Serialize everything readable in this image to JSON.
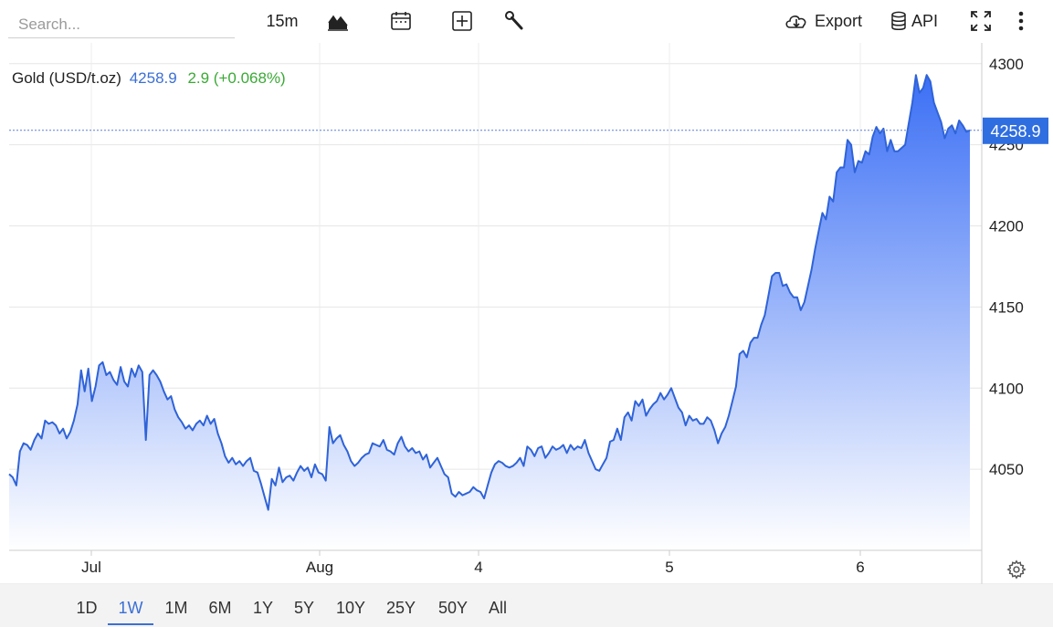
{
  "toolbar": {
    "search_placeholder": "Search...",
    "interval": "15m",
    "export_label": "Export",
    "api_label": "API",
    "icons": [
      "chart-type-icon",
      "calendar-icon",
      "add-indicator-icon",
      "wrench-icon",
      "cloud-download-icon",
      "database-icon",
      "fullscreen-icon",
      "more-vertical-icon"
    ]
  },
  "quote": {
    "name": "Gold (USD/t.oz)",
    "price": "4258.9",
    "change": "2.9 (+0.068%)"
  },
  "ranges": [
    "1D",
    "1W",
    "1M",
    "6M",
    "1Y",
    "5Y",
    "10Y",
    "25Y",
    "50Y",
    "All"
  ],
  "active_range": "1W",
  "colors": {
    "line": "#2f63d8",
    "area_top": "#3b6ff5",
    "area_bottom": "#ffffff",
    "price_label_bg": "#2f6ee0",
    "positive": "#3aaa35",
    "grid": "#e6e6e6"
  },
  "chart_data": {
    "type": "area",
    "title": "Gold (USD/t.oz)",
    "x_tick_labels": [
      "Jul",
      "Aug",
      "4",
      "5",
      "6"
    ],
    "y_ticks": [
      4050,
      4100,
      4150,
      4200,
      4250,
      4300
    ],
    "y_tick_labels": [
      "4050",
      "4100",
      "4150",
      "4200",
      "4250",
      "4300"
    ],
    "ylim": [
      4000,
      4312.8
    ],
    "last_price_label": "4258.9",
    "grid": true,
    "series": [
      {
        "values": [
          4047,
          4045,
          4040,
          4061,
          4066,
          4065,
          4062,
          4068,
          4072,
          4069,
          4080,
          4078,
          4079,
          4077,
          4072,
          4075,
          4069,
          4073,
          4080,
          4090,
          4111,
          4098,
          4112,
          4092,
          4101,
          4114,
          4116,
          4108,
          4110,
          4105,
          4102,
          4113,
          4104,
          4101,
          4112,
          4107,
          4114,
          4110,
          4068,
          4108,
          4111,
          4108,
          4104,
          4098,
          4093,
          4095,
          4087,
          4082,
          4079,
          4075,
          4077,
          4074,
          4078,
          4080,
          4077,
          4083,
          4078,
          4081,
          4072,
          4066,
          4058,
          4054,
          4057,
          4053,
          4055,
          4052,
          4055,
          4057,
          4049,
          4048,
          4041,
          4033,
          4025,
          4044,
          4040,
          4051,
          4042,
          4045,
          4046,
          4043,
          4048,
          4052,
          4049,
          4051,
          4045,
          4053,
          4048,
          4047,
          4043,
          4076,
          4066,
          4069,
          4071,
          4065,
          4061,
          4055,
          4052,
          4054,
          4057,
          4059,
          4060,
          4066,
          4065,
          4064,
          4068,
          4062,
          4061,
          4059,
          4066,
          4070,
          4064,
          4061,
          4063,
          4060,
          4061,
          4056,
          4059,
          4051,
          4054,
          4057,
          4052,
          4047,
          4045,
          4035,
          4033,
          4036,
          4034,
          4035,
          4036,
          4039,
          4037,
          4036,
          4032,
          4040,
          4048,
          4053,
          4055,
          4054,
          4052,
          4051,
          4052,
          4054,
          4057,
          4052,
          4064,
          4062,
          4058,
          4063,
          4064,
          4057,
          4060,
          4064,
          4062,
          4063,
          4065,
          4060,
          4065,
          4062,
          4064,
          4063,
          4068,
          4060,
          4055,
          4050,
          4049,
          4053,
          4057,
          4067,
          4068,
          4075,
          4068,
          4082,
          4085,
          4080,
          4092,
          4089,
          4093,
          4083,
          4087,
          4090,
          4092,
          4097,
          4093,
          4096,
          4100,
          4094,
          4088,
          4085,
          4077,
          4083,
          4080,
          4081,
          4078,
          4078,
          4082,
          4080,
          4074,
          4066,
          4072,
          4076,
          4083,
          4092,
          4101,
          4121,
          4123,
          4119,
          4128,
          4131,
          4131,
          4139,
          4145,
          4157,
          4169,
          4171,
          4171,
          4163,
          4164,
          4159,
          4156,
          4156,
          4148,
          4153,
          4163,
          4173,
          4186,
          4197,
          4208,
          4204,
          4218,
          4215,
          4233,
          4236,
          4236,
          4253,
          4250,
          4233,
          4240,
          4239,
          4246,
          4244,
          4255,
          4261,
          4257,
          4260,
          4246,
          4253,
          4246,
          4246,
          4248,
          4250,
          4263,
          4276,
          4293,
          4282,
          4285,
          4293,
          4289,
          4276,
          4270,
          4264,
          4254,
          4260,
          4262,
          4257,
          4265,
          4262,
          4258,
          4258.9
        ]
      }
    ]
  }
}
